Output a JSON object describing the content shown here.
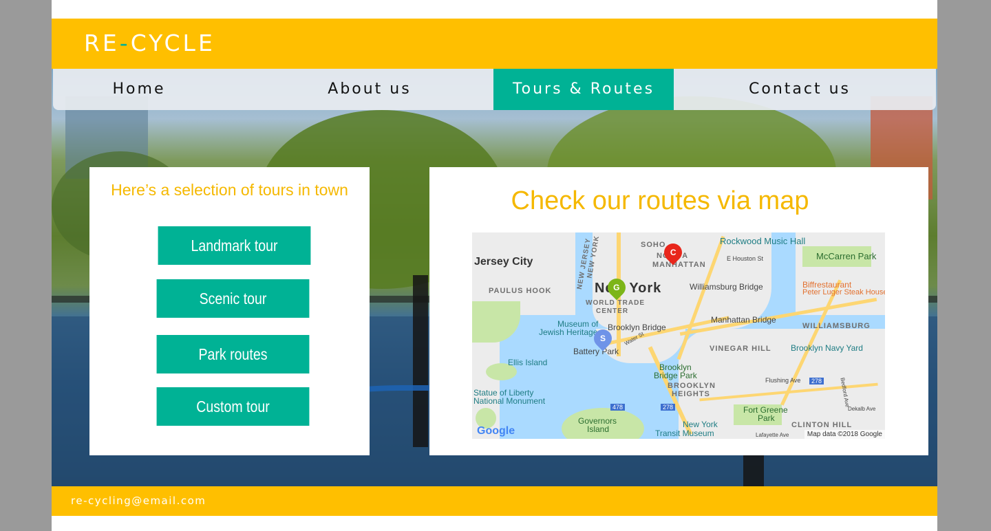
{
  "brand": {
    "logo_left": "RE",
    "logo_dash": "-",
    "logo_right": "CYCLE",
    "colors": {
      "accent": "#ffbf00",
      "teal": "#00b295",
      "title": "#f5b800"
    }
  },
  "nav": {
    "items": [
      {
        "label": "Home"
      },
      {
        "label": "About us"
      },
      {
        "label": "Tours & Routes",
        "active": true
      },
      {
        "label": "Contact us"
      }
    ]
  },
  "tours": {
    "title": "Here’s a selection of tours in town",
    "buttons": [
      {
        "label": "Landmark tour"
      },
      {
        "label": "Scenic tour"
      },
      {
        "label": "Park routes"
      },
      {
        "label": "Custom tour"
      }
    ]
  },
  "map_section": {
    "title": "Check our routes via map",
    "map": {
      "labels": {
        "jersey_city": "Jersey City",
        "paulus_hook": "PAULUS HOOK",
        "new_jersey": "NEW JERSEY",
        "new_york_state": "NEW YORK",
        "soho": "SOHO",
        "nolita": "NOLITA",
        "manhattan": "MANHATTAN",
        "rockwood": "Rockwood Music Hall",
        "houston": "E Houston St",
        "mccarren": "McCarren Park",
        "new_york_city": "New York",
        "williamsburg_bridge": "Williamsburg Bridge",
        "biffrestaurant": "Biffrestaurant",
        "peter_luger": "Peter Luger Steak House",
        "wtc_1": "WORLD TRADE",
        "wtc_2": "CENTER",
        "museum_1": "Museum of",
        "museum_2": "Jewish Heritage",
        "brooklyn_bridge": "Brooklyn Bridge",
        "manhattan_bridge": "Manhattan Bridge",
        "williamsburg": "WILLIAMSBURG",
        "vinegar_hill": "VINEGAR HILL",
        "brooklyn_navy_yard": "Brooklyn Navy Yard",
        "battery_park": "Battery Park",
        "water_st": "Water St",
        "ellis_island": "Ellis Island",
        "bb_park_1": "Brooklyn",
        "bb_park_2": "Bridge Park",
        "flushing": "Flushing Ave",
        "brooklyn_heights_1": "BROOKLYN",
        "brooklyn_heights_2": "HEIGHTS",
        "liberty_1": "Statue of Liberty",
        "liberty_2": "National Monument",
        "fort_greene_1": "Fort Greene",
        "fort_greene_2": "Park",
        "clinton_hill": "CLINTON HILL",
        "governors_1": "Governors",
        "governors_2": "Island",
        "transit_1": "New York",
        "transit_2": "Transit Museum",
        "lafayette": "Lafayette Ave",
        "bedford": "Bedford Ave",
        "dekalb": "Dekalb Ave",
        "shield_478": "478",
        "shield_278a": "278",
        "shield_278b": "278"
      },
      "pins": [
        {
          "letter": "C",
          "color": "#e8261b"
        },
        {
          "letter": "G",
          "color": "#7cb518"
        },
        {
          "letter": "S",
          "color": "#6f93e8"
        }
      ],
      "google": "Google",
      "attribution": "Map data ©2018 Google"
    }
  },
  "footer": {
    "email": "re-cycling@email.com"
  }
}
